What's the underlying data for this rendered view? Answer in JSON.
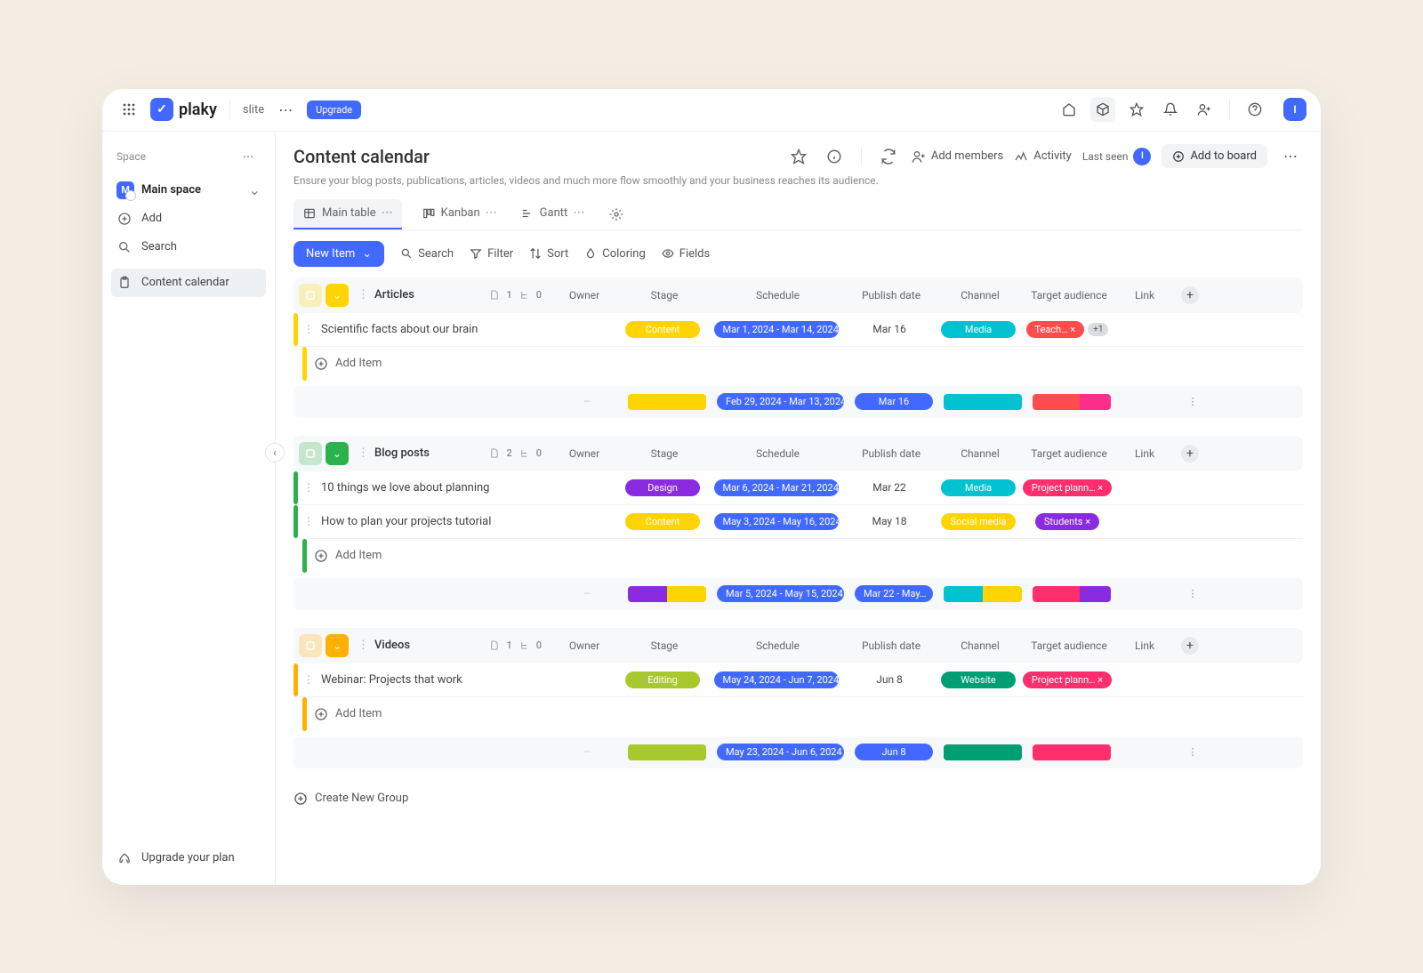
{
  "topbar": {
    "logo_text": "plaky",
    "workspace": "slite",
    "upgrade": "Upgrade",
    "avatar_initial": "I"
  },
  "sidebar": {
    "heading": "Space",
    "space_name": "Main space",
    "space_initial": "M",
    "add": "Add",
    "search": "Search",
    "board": "Content calendar",
    "upgrade_plan": "Upgrade your plan"
  },
  "page": {
    "title": "Content calendar",
    "description": "Ensure your blog posts, publications, articles, videos and much more flow smoothly and your business reaches its audience.",
    "add_members": "Add members",
    "activity": "Activity",
    "last_seen": "Last seen",
    "last_seen_initial": "I",
    "add_to_board": "Add to board"
  },
  "tabs": {
    "main_table": "Main table",
    "kanban": "Kanban",
    "gantt": "Gantt"
  },
  "toolbar": {
    "new_item": "New Item",
    "search": "Search",
    "filter": "Filter",
    "sort": "Sort",
    "coloring": "Coloring",
    "fields": "Fields"
  },
  "columns": {
    "owner": "Owner",
    "stage": "Stage",
    "schedule": "Schedule",
    "publish": "Publish date",
    "channel": "Channel",
    "audience": "Target audience",
    "link": "Link"
  },
  "add_item": "Add Item",
  "create_group": "Create New Group",
  "groups": [
    {
      "name": "Articles",
      "color": "#ffd400",
      "count_items": "1",
      "count_sub": "0",
      "rows": [
        {
          "title": "Scientific facts about our brain",
          "stage": {
            "label": "Content",
            "color": "#ffd400"
          },
          "schedule": "Mar 1, 2024 - Mar 14, 2024",
          "publish": "Mar 16",
          "channel": {
            "label": "Media",
            "color": "#00c2d1"
          },
          "audience": {
            "label": "Teach…",
            "color": "#ff4d4d",
            "extra": "+1"
          }
        }
      ],
      "summary": {
        "stage_segments": [
          {
            "color": "#ffd400",
            "pct": 100
          }
        ],
        "schedule": "Feb 29, 2024 - Mar 13, 2024",
        "publish": "Mar 16",
        "channel_segments": [
          {
            "color": "#00c2d1",
            "pct": 100
          }
        ],
        "audience_segments": [
          {
            "color": "#ff4d4d",
            "pct": 60
          },
          {
            "color": "#ff2e8b",
            "pct": 40
          }
        ]
      }
    },
    {
      "name": "Blog posts",
      "color": "#2bb24c",
      "count_items": "2",
      "count_sub": "0",
      "rows": [
        {
          "title": "10 things we love about planning",
          "stage": {
            "label": "Design",
            "color": "#8a2be2"
          },
          "schedule": "Mar 6, 2024 - Mar 21, 2024",
          "publish": "Mar 22",
          "channel": {
            "label": "Media",
            "color": "#00c2d1"
          },
          "audience": {
            "label": "Project plann…",
            "color": "#ff2e6c"
          }
        },
        {
          "title": "How to plan your projects tutorial",
          "stage": {
            "label": "Content",
            "color": "#ffd400"
          },
          "schedule": "May 3, 2024 - May 16, 2024",
          "publish": "May 18",
          "channel": {
            "label": "Social media",
            "color": "#ffd400"
          },
          "audience": {
            "label": "Students",
            "color": "#8a2be2"
          }
        }
      ],
      "summary": {
        "stage_segments": [
          {
            "color": "#8a2be2",
            "pct": 50
          },
          {
            "color": "#ffd400",
            "pct": 50
          }
        ],
        "schedule": "Mar 5, 2024 - May 15, 2024",
        "publish": "Mar 22 - May…",
        "channel_segments": [
          {
            "color": "#00c2d1",
            "pct": 50
          },
          {
            "color": "#ffd400",
            "pct": 50
          }
        ],
        "audience_segments": [
          {
            "color": "#ff2e6c",
            "pct": 60
          },
          {
            "color": "#8a2be2",
            "pct": 40
          }
        ]
      }
    },
    {
      "name": "Videos",
      "color": "#ffb000",
      "count_items": "1",
      "count_sub": "0",
      "rows": [
        {
          "title": "Webinar: Projects that work",
          "stage": {
            "label": "Editing",
            "color": "#a8c92b"
          },
          "schedule": "May 24, 2024 - Jun 7, 2024",
          "publish": "Jun 8",
          "channel": {
            "label": "Website",
            "color": "#009e73"
          },
          "audience": {
            "label": "Project plann…",
            "color": "#ff2e6c"
          }
        }
      ],
      "summary": {
        "stage_segments": [
          {
            "color": "#a8c92b",
            "pct": 100
          }
        ],
        "schedule": "May 23, 2024 - Jun 6, 2024",
        "publish": "Jun 8",
        "channel_segments": [
          {
            "color": "#009e73",
            "pct": 100
          }
        ],
        "audience_segments": [
          {
            "color": "#ff2e6c",
            "pct": 100
          }
        ]
      }
    }
  ]
}
